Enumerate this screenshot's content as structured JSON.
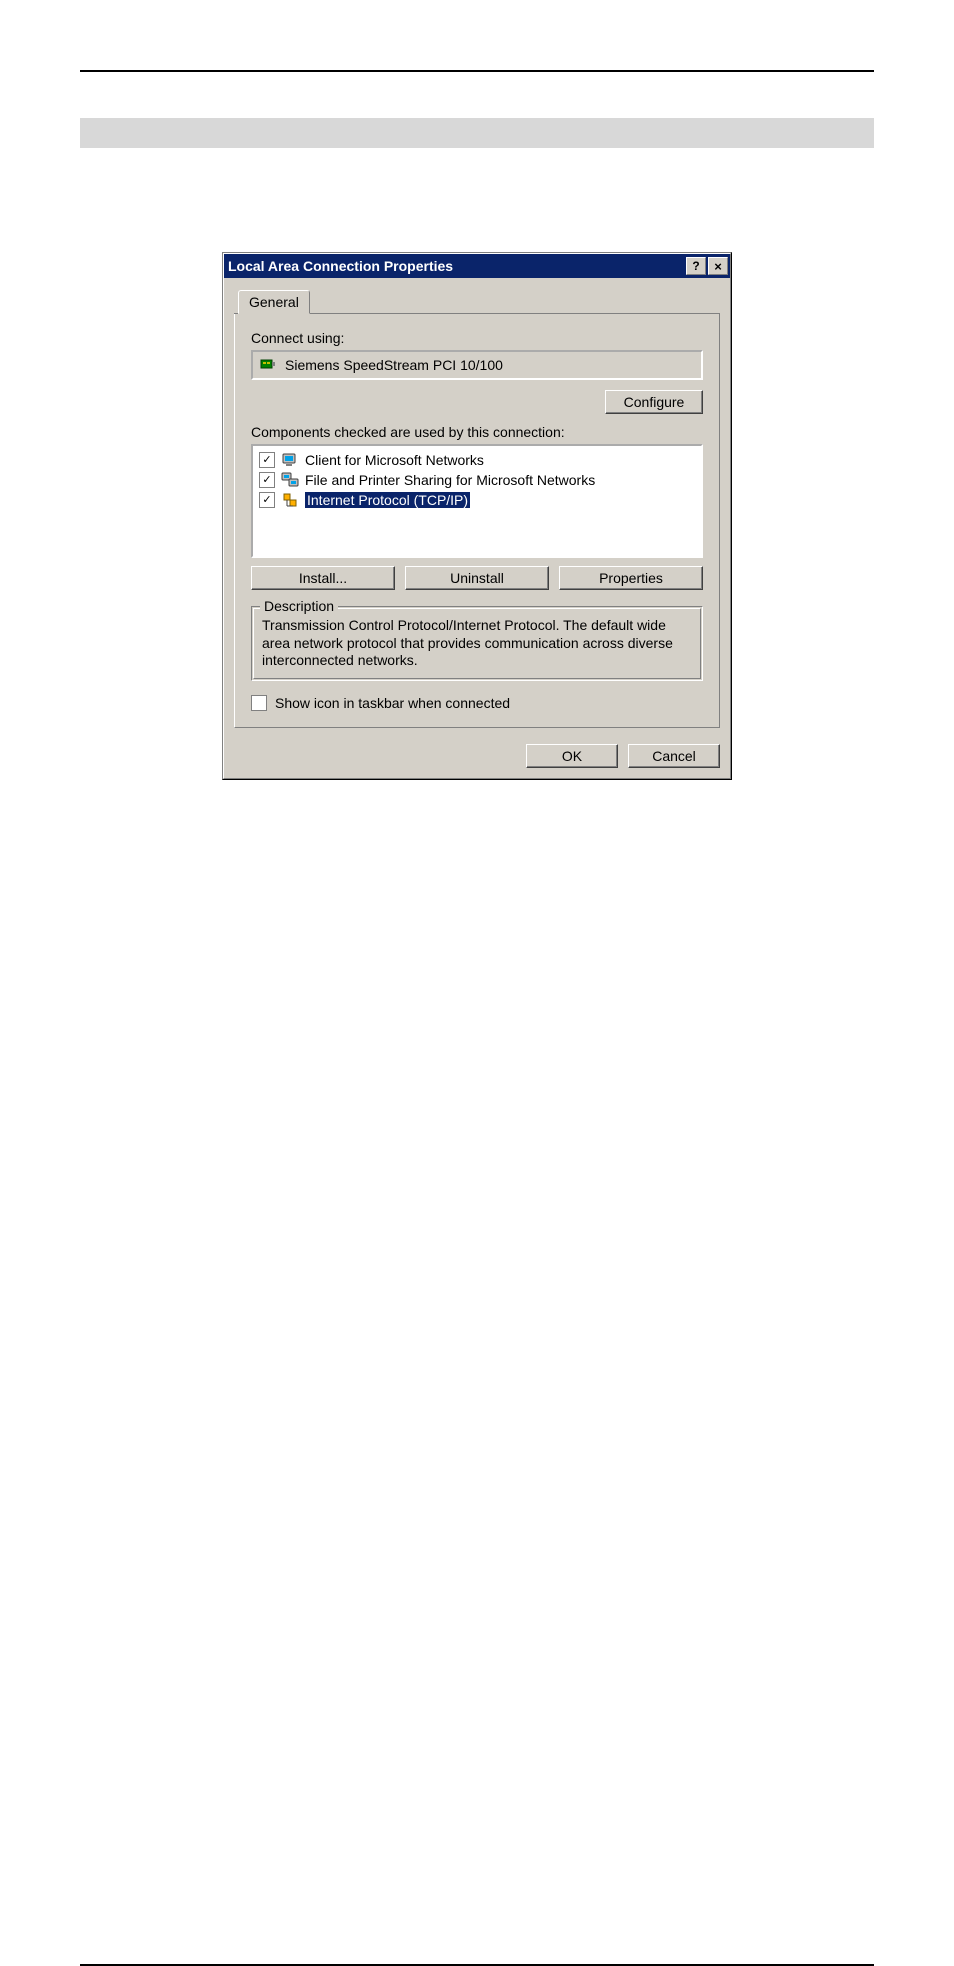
{
  "window": {
    "title": "Local Area Connection Properties",
    "help_glyph": "?",
    "close_glyph": "×"
  },
  "tabs": {
    "general": "General"
  },
  "connect": {
    "label": "Connect using:",
    "adapter": "Siemens SpeedStream PCI 10/100",
    "configure": "Configure"
  },
  "components": {
    "label": "Components checked are used by this connection:",
    "items": [
      {
        "label": "Client for Microsoft Networks",
        "checked": true,
        "selected": false,
        "icon": "monitor"
      },
      {
        "label": "File and Printer Sharing for Microsoft Networks",
        "checked": true,
        "selected": false,
        "icon": "monitor-share"
      },
      {
        "label": "Internet Protocol (TCP/IP)",
        "checked": true,
        "selected": true,
        "icon": "protocol"
      }
    ],
    "install": "Install...",
    "uninstall": "Uninstall",
    "properties": "Properties"
  },
  "description": {
    "legend": "Description",
    "text": "Transmission Control Protocol/Internet Protocol. The default wide area network protocol that provides communication across diverse interconnected networks."
  },
  "show_icon": {
    "checked": false,
    "label": "Show icon in taskbar when connected"
  },
  "buttons": {
    "ok": "OK",
    "cancel": "Cancel"
  }
}
